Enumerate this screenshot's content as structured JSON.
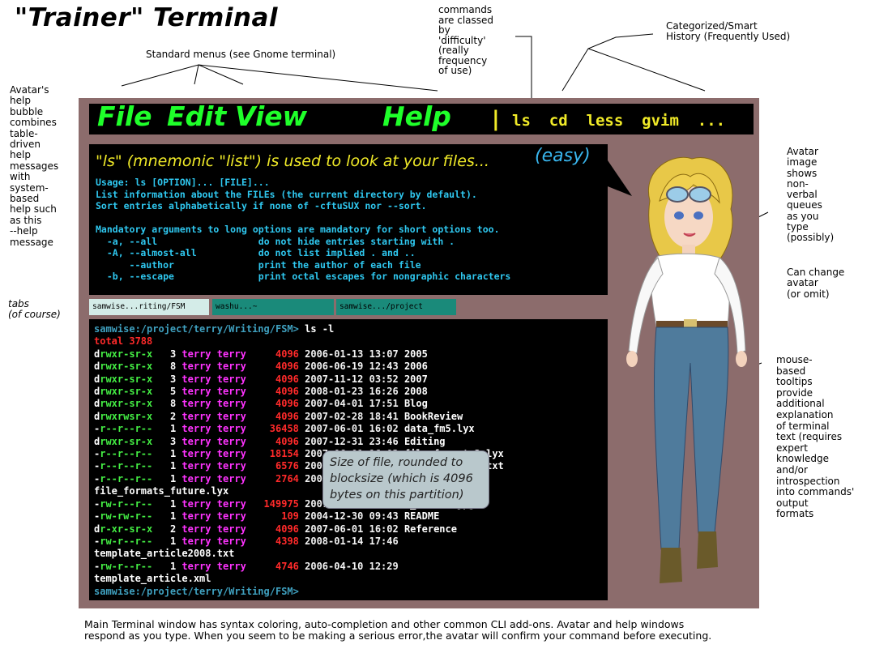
{
  "title": "\"Trainer\" Terminal",
  "annotations": {
    "menus": "Standard menus (see Gnome terminal)",
    "commands": "commands\nare classed\nby\n'difficulty'\n(really\nfrequency\nof use)",
    "history": "Categorized/Smart\nHistory (Frequently Used)",
    "avatar_help": "Avatar's\nhelp\nbubble\ncombines\ntable-\ndriven\nhelp\nmessages\nwith\nsystem-\nbased\nhelp such\nas this\n--help\nmessage",
    "tabs": "tabs\n(of course)",
    "avatar_image": "Avatar\nimage\nshows\nnon-\nverbal\nqueues\nas you\ntype\n(possibly)",
    "change_avatar": "Can change\navatar\n(or omit)",
    "tooltips": "mouse-\nbased\ntooltips\nprovide\nadditional\nexplanation\nof terminal\ntext (requires\nexpert\nknowledge\nand/or\nintrospection\ninto commands'\noutput\nformats",
    "bottom": "Main Terminal window has syntax coloring, auto-completion and other common CLI add-ons. Avatar and help windows\nrespond as you type. When you seem to be making a serious error,the avatar will confirm your command before executing."
  },
  "menubar": {
    "items": [
      "File",
      "Edit",
      "View",
      "Help"
    ],
    "separator": "|",
    "commands": "ls  cd  less  gvim  ...",
    "color": "#1fff2a",
    "command_color": "#f0ea28"
  },
  "help": {
    "heading": "\"ls\" (mnemonic \"list\") is used to look at your files...",
    "difficulty": "(easy)",
    "body": "Usage: ls [OPTION]... [FILE]...\nList information about the FILEs (the current directory by default).\nSort entries alphabetically if none of -cftuSUX nor --sort.\n\nMandatory arguments to long options are mandatory for short options too.\n  -a, --all                  do not hide entries starting with .\n  -A, --almost-all           do not list implied . and ..\n      --author               print the author of each file\n  -b, --escape               print octal escapes for nongraphic characters"
  },
  "tabs": [
    {
      "label": "samwise...riting/FSM",
      "color": "#d4ece8"
    },
    {
      "label": "washu...~",
      "color": "#1a8a7a"
    },
    {
      "label": "samwise.../project",
      "color": "#1a8a7a"
    }
  ],
  "terminal": {
    "prompt": "samwise:/project/terry/Writing/FSM>",
    "command": "ls -l",
    "total": "total 3788",
    "rows": [
      {
        "perm": "drwxr-sr-x",
        "links": "3",
        "user": "terry",
        "group": "terry",
        "size": "4096",
        "date": "2006-01-13 13:07",
        "name": "2005"
      },
      {
        "perm": "drwxr-sr-x",
        "links": "8",
        "user": "terry",
        "group": "terry",
        "size": "4096",
        "date": "2006-06-19 12:43",
        "name": "2006"
      },
      {
        "perm": "drwxr-sr-x",
        "links": "3",
        "user": "terry",
        "group": "terry",
        "size": "4096",
        "date": "2007-11-12 03:52",
        "name": "2007"
      },
      {
        "perm": "drwxr-sr-x",
        "links": "5",
        "user": "terry",
        "group": "terry",
        "size": "4096",
        "date": "2008-01-23 16:26",
        "name": "2008"
      },
      {
        "perm": "drwxr-sr-x",
        "links": "8",
        "user": "terry",
        "group": "terry",
        "size": "4096",
        "date": "2007-04-01 17:51",
        "name": "Blog"
      },
      {
        "perm": "drwxrwsr-x",
        "links": "2",
        "user": "terry",
        "group": "terry",
        "size": "4096",
        "date": "2007-02-28 18:41",
        "name": "BookReview"
      },
      {
        "perm": "-r--r--r--",
        "links": "1",
        "user": "terry",
        "group": "terry",
        "size": "36458",
        "date": "2007-06-01 16:02",
        "name": "data_fm5.lyx"
      },
      {
        "perm": "drwxr-sr-x",
        "links": "3",
        "user": "terry",
        "group": "terry",
        "size": "4096",
        "date": "2007-12-31 23:46",
        "name": "Editing"
      },
      {
        "perm": "-r--r--r--",
        "links": "1",
        "user": "terry",
        "group": "terry",
        "size": "18154",
        "date": "2007-06-01 16:02",
        "name": "file_formats2.lyx"
      },
      {
        "perm": "-r--r--r--",
        "links": "1",
        "user": "terry",
        "group": "terry",
        "size": "6576",
        "date": "2007-06-01 16:02",
        "name": "file_formats2.txt"
      },
      {
        "perm": "-r--r--r--",
        "links": "1",
        "user": "terry",
        "group": "terry",
        "size": "2764",
        "date": "2007-06-01 16:02",
        "name": ""
      }
    ],
    "wrap1": "file_formats_future.lyx",
    "rows2": [
      {
        "perm": "-rw-r--r--",
        "links": "1",
        "user": "terry",
        "group": "terry",
        "size": "149975",
        "date": "2007-06-01 16:02",
        "name": "d_letter.jpg"
      },
      {
        "perm": "-rw-rw-r--",
        "links": "1",
        "user": "terry",
        "group": "terry",
        "size": "109",
        "date": "2004-12-30 09:43",
        "name": "README"
      },
      {
        "perm": "dr-xr-sr-x",
        "links": "2",
        "user": "terry",
        "group": "terry",
        "size": "4096",
        "date": "2007-06-01 16:02",
        "name": "Reference"
      },
      {
        "perm": "-rw-r--r--",
        "links": "1",
        "user": "terry",
        "group": "terry",
        "size": "4398",
        "date": "2008-01-14 17:46",
        "name": ""
      }
    ],
    "wrap2": "template_article2008.txt",
    "row3": {
      "perm": "-rw-r--r--",
      "links": "1",
      "user": "terry",
      "group": "terry",
      "size": "4746",
      "date": "2006-04-10 12:29",
      "name": ""
    },
    "wrap3": "template_article.xml",
    "final_prompt": "samwise:/project/terry/Writing/FSM>"
  },
  "tooltip": "Size of file, rounded to blocksize (which is 4096 bytes on this partition)",
  "colors": {
    "panel": "#8c6c6c",
    "prompt": "#3fa0bf",
    "size": "#ff2a2a",
    "user": "#ff33ff",
    "perm": "#44ee44",
    "help_text": "#2fc8f0"
  }
}
